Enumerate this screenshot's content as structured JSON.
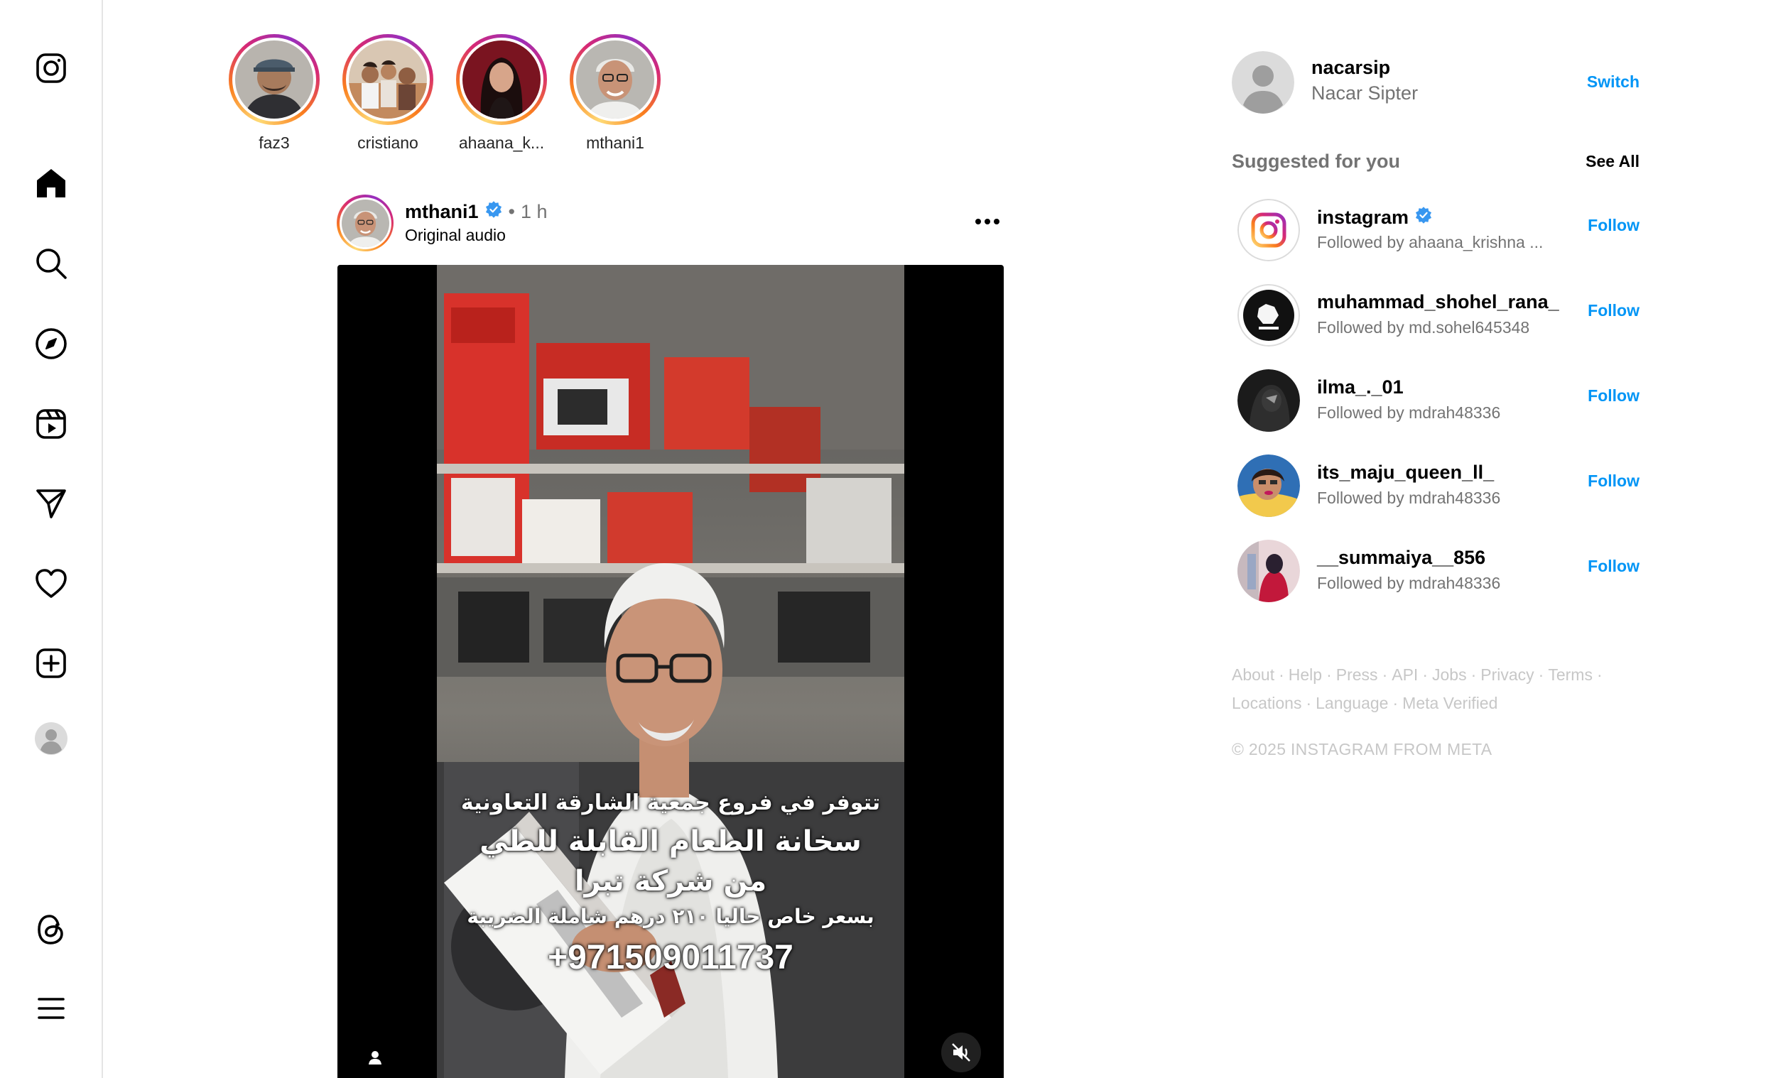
{
  "stories": [
    {
      "username": "faz3"
    },
    {
      "username": "cristiano"
    },
    {
      "username": "ahaana_k..."
    },
    {
      "username": "mthani1"
    }
  ],
  "post": {
    "username": "mthani1",
    "time": "1 h",
    "separator": "•",
    "audio": "Original audio",
    "caption": [
      "تتوفر في فروع جمعية الشارقة التعاونية",
      "سخانة الطعام القابلة للطي",
      "من شركة تبرا",
      "بسعر خاص حاليا ٢١٠ درهم شاملة الضريبة",
      "+971509011737"
    ]
  },
  "account": {
    "username": "nacarsip",
    "full_name": "Nacar Sipter",
    "switch_label": "Switch"
  },
  "suggestions": {
    "title": "Suggested for you",
    "see_all": "See All",
    "follow_label": "Follow",
    "items": [
      {
        "username": "instagram",
        "verified": true,
        "subtitle": "Followed by ahaana_krishna ..."
      },
      {
        "username": "muhammad_shohel_rana_",
        "verified": false,
        "subtitle": "Followed by md.sohel645348"
      },
      {
        "username": "ilma_._01",
        "verified": false,
        "subtitle": "Followed by mdrah48336"
      },
      {
        "username": "its_maju_queen_ll_",
        "verified": false,
        "subtitle": "Followed by mdrah48336"
      },
      {
        "username": "__summaiya__856",
        "verified": false,
        "subtitle": "Followed by mdrah48336"
      }
    ]
  },
  "footer": {
    "links": [
      "About",
      "Help",
      "Press",
      "API",
      "Jobs",
      "Privacy",
      "Terms",
      "Locations",
      "Language",
      "Meta Verified"
    ],
    "copyright": "© 2025 INSTAGRAM FROM META"
  },
  "colors": {
    "accent": "#0095f6",
    "verified": "#3897f0",
    "muted": "#737373",
    "footer": "#c7c7c7"
  }
}
